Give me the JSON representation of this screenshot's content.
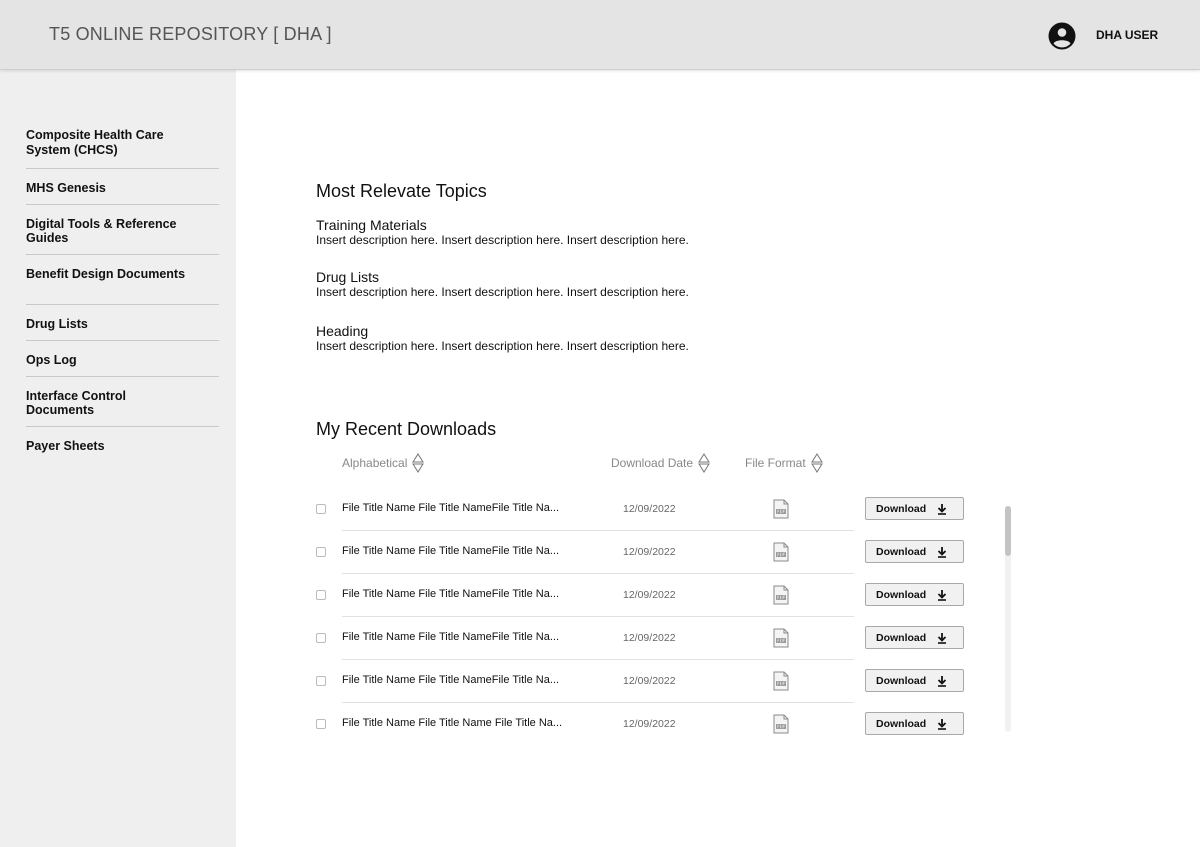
{
  "header": {
    "title": "T5 ONLINE REPOSITORY [ DHA ]",
    "user_name": "DHA USER",
    "avatar_icon": "account-circle-icon"
  },
  "sidebar": {
    "items": [
      {
        "label": "Composite Health Care System (CHCS)"
      },
      {
        "label": "MHS Genesis"
      },
      {
        "label": "Digital Tools & Reference Guides"
      },
      {
        "label": "Benefit Design Documents"
      },
      {
        "label": "Drug Lists"
      },
      {
        "label": "Ops Log"
      },
      {
        "label": "Interface Control Documents"
      },
      {
        "label": "Payer Sheets"
      }
    ]
  },
  "topics": {
    "title": "Most Relevate Topics",
    "items": [
      {
        "heading": "Training Materials",
        "description": "Insert description here. Insert description here. Insert description here."
      },
      {
        "heading": "Drug Lists",
        "description": "Insert description here. Insert description here. Insert description here."
      },
      {
        "heading": "Heading",
        "description": "Insert description here. Insert description here. Insert description here."
      }
    ]
  },
  "downloads": {
    "title": "My Recent Downloads",
    "columns": {
      "name": "Alphabetical",
      "date": "Download Date",
      "format": "File Format"
    },
    "sort_icon": "sort-up-down-icon",
    "file_icon": "pdf-file-icon",
    "download_icon": "download-arrow-icon",
    "rows": [
      {
        "name": "File Title Name File Title NameFile Title Na...",
        "date": "12/09/2022",
        "action": "Download"
      },
      {
        "name": "File Title Name File Title NameFile Title Na...",
        "date": "12/09/2022",
        "action": "Download"
      },
      {
        "name": "File Title Name File Title NameFile Title Na...",
        "date": "12/09/2022",
        "action": "Download"
      },
      {
        "name": "File Title Name File Title NameFile Title Na...",
        "date": "12/09/2022",
        "action": "Download"
      },
      {
        "name": "File Title Name File Title NameFile Title Na...",
        "date": "12/09/2022",
        "action": "Download"
      },
      {
        "name": "File Title Name File Title Name File Title Na...",
        "date": "12/09/2022",
        "action": "Download"
      }
    ]
  }
}
